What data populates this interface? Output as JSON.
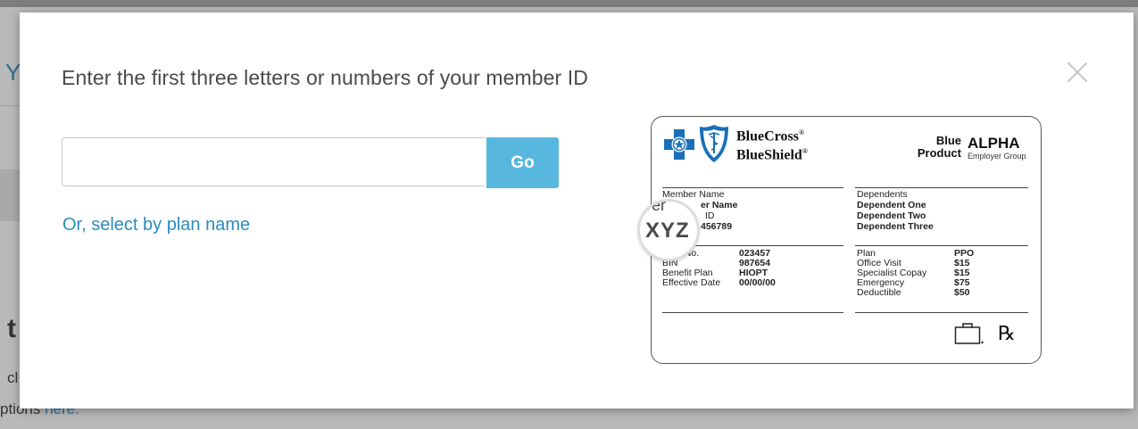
{
  "background": {
    "letter_y": "Y",
    "letter_t": "t",
    "letter_c": "cl",
    "footer_prefix": "ptions ",
    "footer_link": "here."
  },
  "modal": {
    "prompt": "Enter the first three letters or numbers of your member ID",
    "input_value": "",
    "input_placeholder": "",
    "go_label": "Go",
    "plan_link": "Or, select by plan name",
    "close_icon": "close-x-icon"
  },
  "card": {
    "brand_line1": "BlueCross",
    "brand_line2": "BlueShield",
    "product_line1": "Blue",
    "product_line2": "Product",
    "group_name": "ALPHA",
    "group_sub": "Employer Group",
    "member_name_label": "Member Name",
    "member_name_value": "er Name",
    "member_id_label": "ID",
    "member_id_value": "456789",
    "magnifier_ghost": "ver",
    "magnifier_prefix": "XYZ",
    "dependents_label": "Dependents",
    "dependents": [
      "Dependent One",
      "Dependent Two",
      "Dependent Three"
    ],
    "left_pairs": [
      {
        "label": "p No.",
        "value": "023457"
      },
      {
        "label": "BIN",
        "value": "987654"
      },
      {
        "label": "Benefit Plan",
        "value": "HIOPT"
      },
      {
        "label": "Effective Date",
        "value": "00/00/00"
      }
    ],
    "right_pairs": [
      {
        "label": "Plan",
        "value": "PPO"
      },
      {
        "label": "Office Visit",
        "value": "$15"
      },
      {
        "label": "Specialist Copay",
        "value": "$15"
      },
      {
        "label": "Emergency",
        "value": "$75"
      },
      {
        "label": "Deductible",
        "value": "$50"
      }
    ],
    "rx_symbol": "℞"
  },
  "colors": {
    "go_button": "#58b7de",
    "link": "#2a8cbf",
    "brand_blue": "#1a6fb8"
  }
}
